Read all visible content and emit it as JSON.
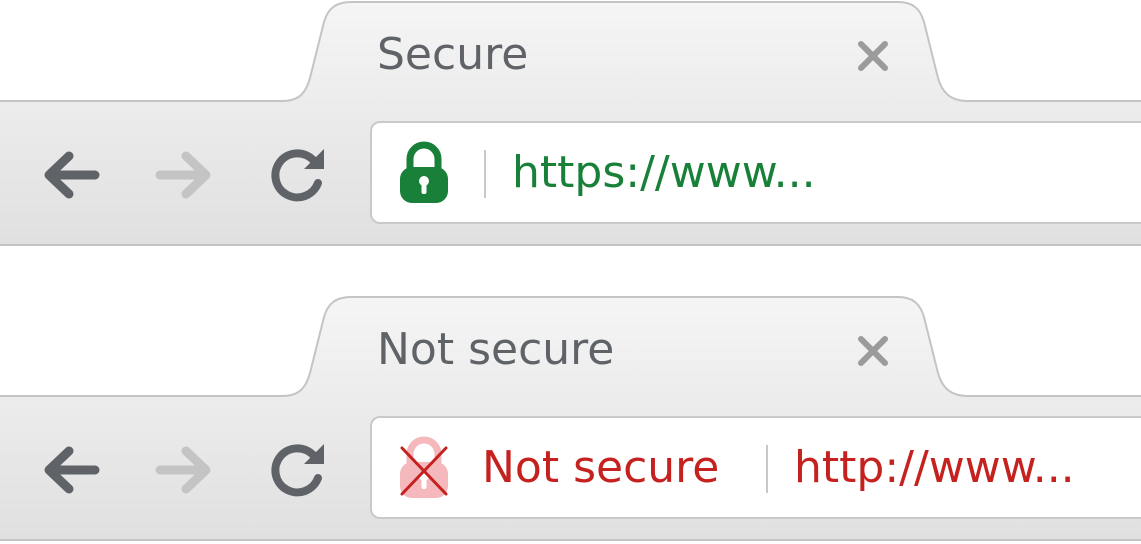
{
  "colors": {
    "secure_green": "#188038",
    "insecure_red": "#c5221f",
    "insecure_lock_pink": "#f4b8bd",
    "tab_text": "#5f6368",
    "nav_icon_active": "#5f6368",
    "nav_icon_disabled": "#c4c4c4"
  },
  "secure_window": {
    "tab": {
      "title": "Secure",
      "close_icon": "close-icon"
    },
    "toolbar": {
      "back_icon": "back-arrow-icon",
      "forward_icon": "forward-arrow-icon",
      "reload_icon": "reload-icon"
    },
    "omnibox": {
      "security_icon": "lock-icon",
      "url": "https://www..."
    }
  },
  "insecure_window": {
    "tab": {
      "title": "Not secure",
      "close_icon": "close-icon"
    },
    "toolbar": {
      "back_icon": "back-arrow-icon",
      "forward_icon": "forward-arrow-icon",
      "reload_icon": "reload-icon"
    },
    "omnibox": {
      "security_icon": "broken-lock-icon",
      "security_label": "Not secure",
      "url": "http://www..."
    }
  }
}
